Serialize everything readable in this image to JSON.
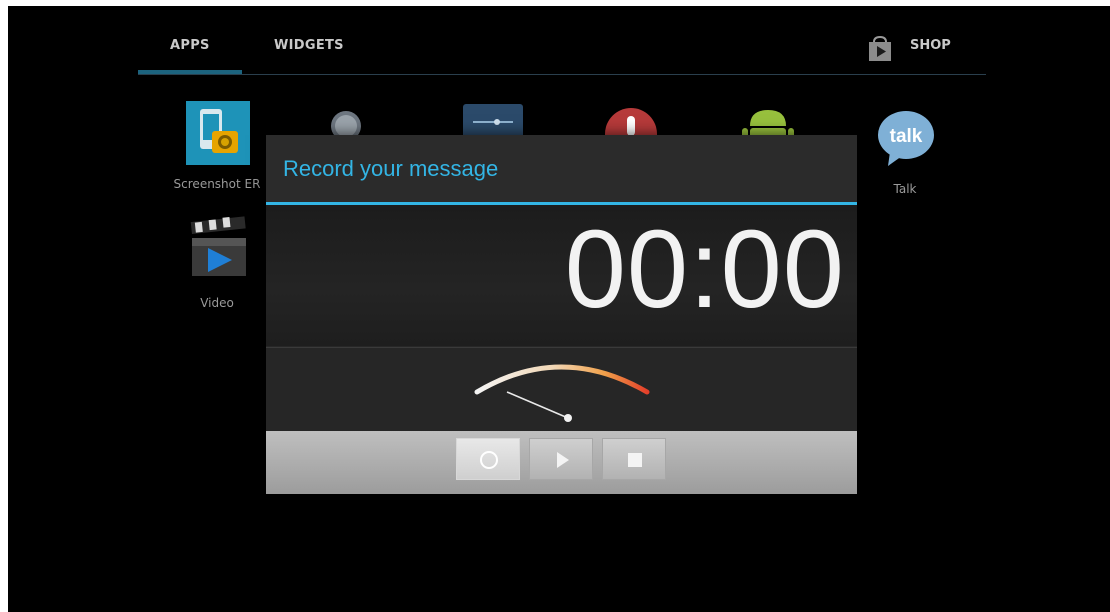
{
  "tabs": [
    {
      "label": "APPS",
      "selected": true
    },
    {
      "label": "WIDGETS",
      "selected": false
    }
  ],
  "shop": {
    "label": "SHOP",
    "icon": "play-store-bag-icon"
  },
  "apps": [
    {
      "label": "Screenshot ER",
      "icon": "screenshot-er-icon"
    },
    {
      "label": "Video",
      "icon": "video-clapperboard-icon"
    },
    {
      "label": "Talk",
      "icon": "talk-bubble-icon",
      "badge_text": "talk"
    }
  ],
  "dialog": {
    "title": "Record your message",
    "timer": "00:00",
    "level_meter_value": 0,
    "controls": [
      {
        "name": "record",
        "icon": "record-icon",
        "enabled": true
      },
      {
        "name": "play",
        "icon": "play-icon",
        "enabled": false
      },
      {
        "name": "stop",
        "icon": "stop-icon",
        "enabled": false
      }
    ]
  },
  "colors": {
    "accent": "#33b5e5",
    "background": "#000000",
    "dialog": "#272727"
  }
}
